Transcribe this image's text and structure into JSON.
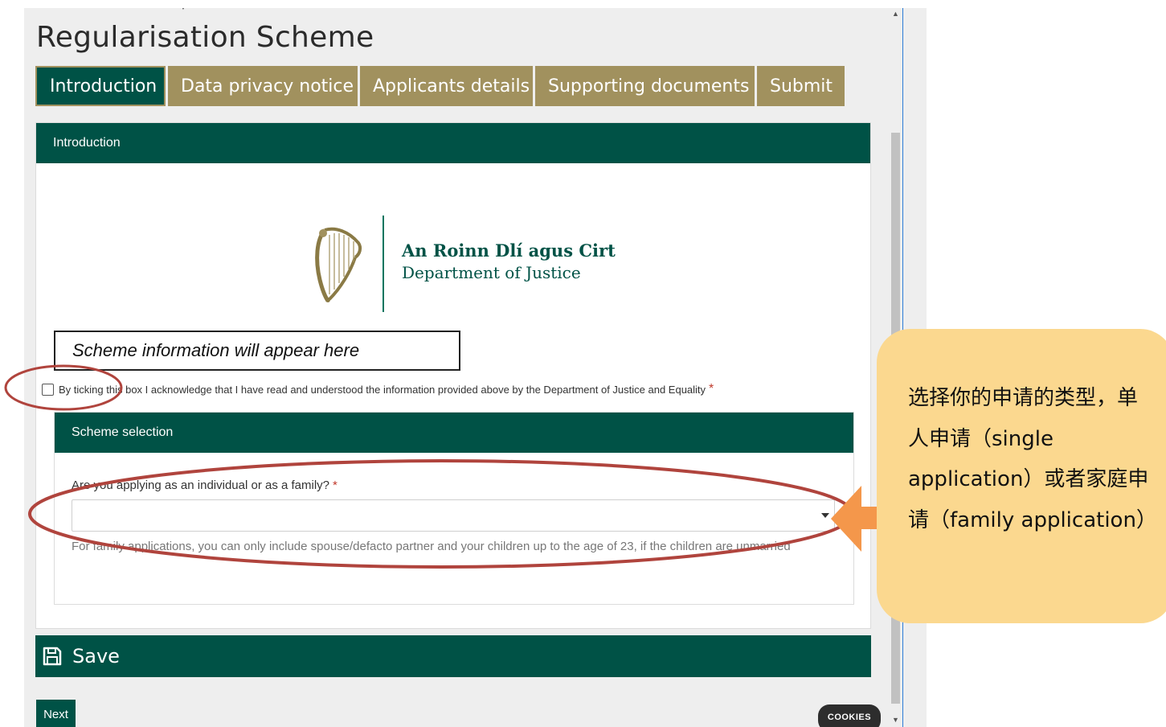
{
  "page": {
    "title": "Regularisation Scheme"
  },
  "tabs": [
    {
      "label": "Introduction",
      "active": true
    },
    {
      "label": "Data privacy notice",
      "active": false
    },
    {
      "label": "Applicants details",
      "active": false
    },
    {
      "label": "Supporting documents",
      "active": false
    },
    {
      "label": "Submit",
      "active": false
    }
  ],
  "intro": {
    "header": "Introduction",
    "logo": {
      "line1": "An Roinn Dlí agus Cirt",
      "line2": "Department of Justice"
    },
    "scheme_info": "Scheme information will appear here",
    "acknowledge": {
      "label": "By ticking this box I acknowledge that I have read and understood the information provided above by the Department of Justice and Equality",
      "required_mark": "*",
      "checked": false
    }
  },
  "scheme_selection": {
    "header": "Scheme selection",
    "question": "Are you applying as an individual or as a family?",
    "required_mark": "*",
    "selected_value": "",
    "help_text": "For family applications, you can only include spouse/defacto partner and your children up to the age of 23, if the children are unmarried"
  },
  "actions": {
    "save_label": "Save",
    "next_label": "Next",
    "cookies_label": "COOKIES"
  },
  "annotation": {
    "text": "选择你的申请的类型，单人申请（single application）或者家庭申请（family application）"
  },
  "colors": {
    "primary": "#005246",
    "tab_gold": "#a1915e",
    "callout_bg": "#fbd88f",
    "arrow": "#f4974b",
    "highlight_ring": "#b0443d",
    "required": "#c0392b"
  }
}
